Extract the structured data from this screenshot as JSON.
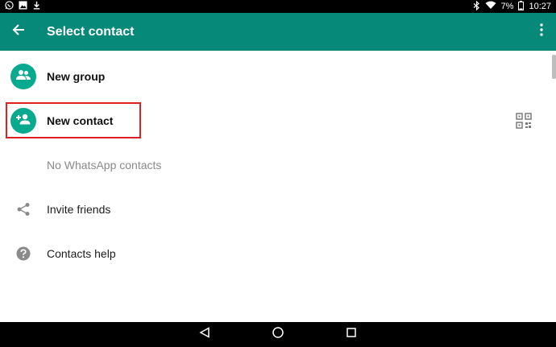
{
  "status_bar": {
    "battery": "7%",
    "time": "10:27"
  },
  "app_bar": {
    "title": "Select contact"
  },
  "list": {
    "new_group": "New group",
    "new_contact": "New contact",
    "no_contacts": "No WhatsApp contacts",
    "invite_friends": "Invite friends",
    "contacts_help": "Contacts help"
  },
  "colors": {
    "accent": "#07897a",
    "avatar": "#07a98f",
    "highlight": "#e02020"
  },
  "icons": {
    "status_left": [
      "whatsapp-icon",
      "image-icon",
      "download-icon"
    ],
    "status_right": [
      "bluetooth-icon",
      "wifi-icon",
      "battery-icon"
    ],
    "app_bar": [
      "back-arrow-icon",
      "more-options-icon"
    ],
    "rows": [
      "group-icon",
      "add-contact-icon",
      "qr-code-icon",
      "share-icon",
      "help-icon"
    ],
    "nav": [
      "back-triangle-icon",
      "home-circle-icon",
      "recents-square-icon"
    ]
  }
}
